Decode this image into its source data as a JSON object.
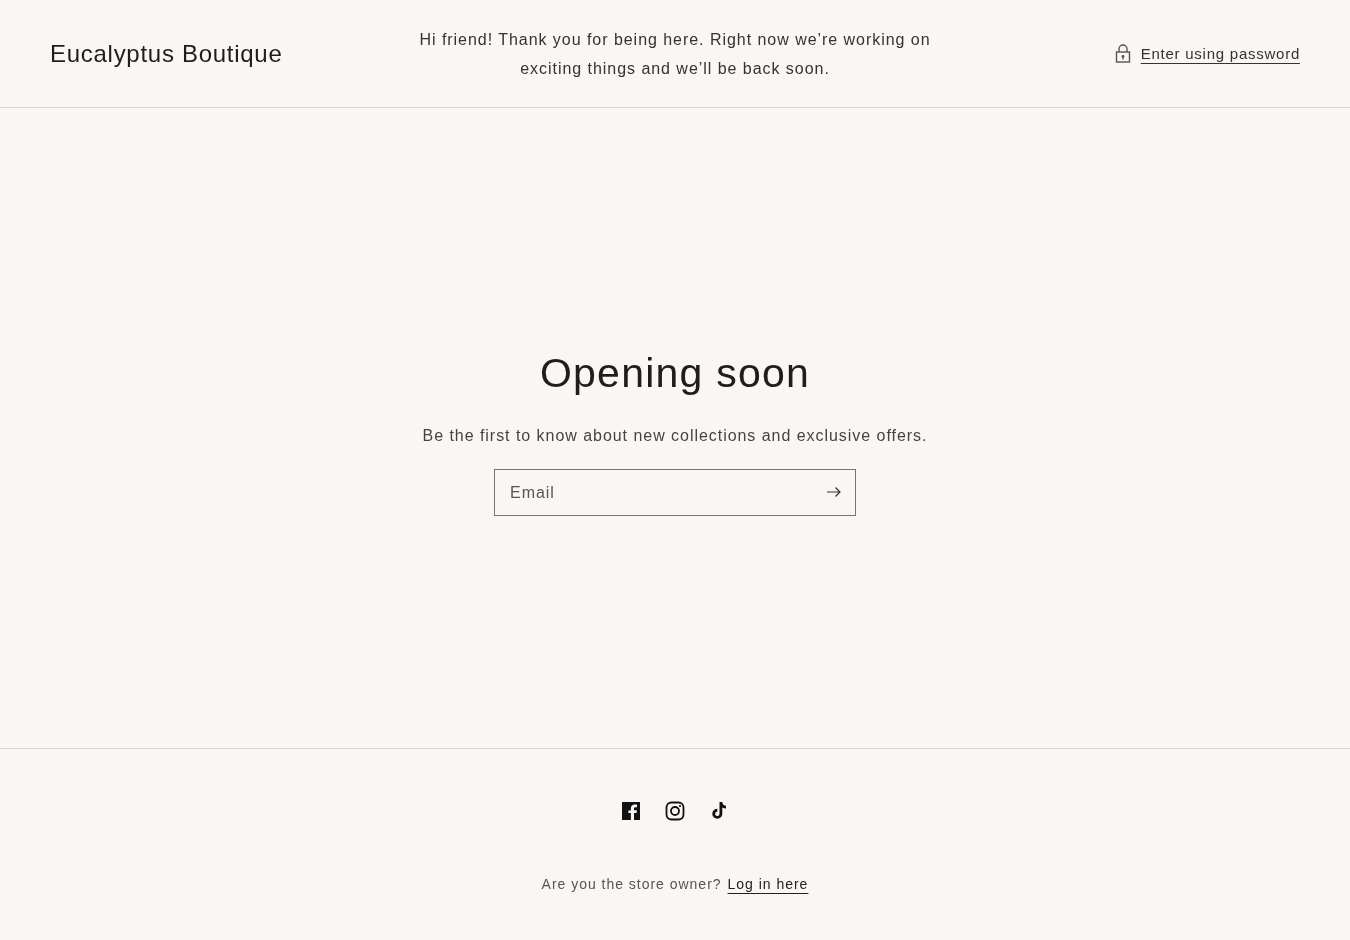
{
  "header": {
    "store_name": "Eucalyptus Boutique",
    "announcement": "Hi friend! Thank you for being here. Right now we’re working on exciting things and we’ll be back soon.",
    "password_link": "Enter using password"
  },
  "main": {
    "heading": "Opening soon",
    "subheading": "Be the first to know about new collections and exclusive offers.",
    "email_field": {
      "placeholder": "Email"
    }
  },
  "footer": {
    "owner_prompt": "Are you the store owner?",
    "login_link": "Log in here"
  }
}
